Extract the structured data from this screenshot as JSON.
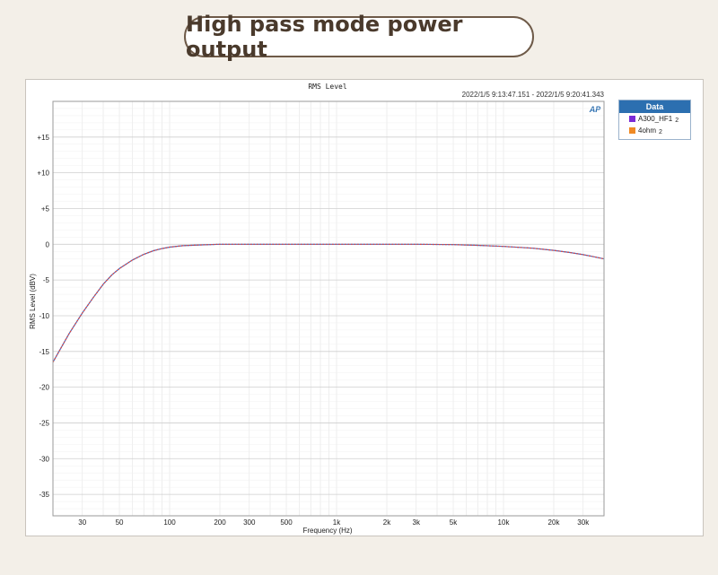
{
  "banner": {
    "title": "High pass mode power output"
  },
  "chart_data": {
    "type": "line",
    "title": "RMS Level",
    "timestamp": "2022/1/5 9:13:47.151 -   2022/1/5 9:20:41.343",
    "logo": "AP",
    "xlabel": "Frequency (Hz)",
    "ylabel": "RMS Level (dBV)",
    "x_scale": "log",
    "xlim": [
      20,
      40000
    ],
    "ylim": [
      -38,
      20
    ],
    "grid": true,
    "legend_position": "right",
    "legend_title": "Data",
    "x_ticks": [
      {
        "value": 30,
        "label": "30"
      },
      {
        "value": 50,
        "label": "50"
      },
      {
        "value": 100,
        "label": "100"
      },
      {
        "value": 200,
        "label": "200"
      },
      {
        "value": 300,
        "label": "300"
      },
      {
        "value": 500,
        "label": "500"
      },
      {
        "value": 1000,
        "label": "1k"
      },
      {
        "value": 2000,
        "label": "2k"
      },
      {
        "value": 3000,
        "label": "3k"
      },
      {
        "value": 5000,
        "label": "5k"
      },
      {
        "value": 10000,
        "label": "10k"
      },
      {
        "value": 20000,
        "label": "20k"
      },
      {
        "value": 30000,
        "label": "30k"
      }
    ],
    "y_ticks": [
      {
        "value": 15,
        "label": "+15"
      },
      {
        "value": 10,
        "label": "+10"
      },
      {
        "value": 5,
        "label": "+5"
      },
      {
        "value": 0,
        "label": "0"
      },
      {
        "value": -5,
        "label": "-5"
      },
      {
        "value": -10,
        "label": "-10"
      },
      {
        "value": -15,
        "label": "-15"
      },
      {
        "value": -20,
        "label": "-20"
      },
      {
        "value": -25,
        "label": "-25"
      },
      {
        "value": -30,
        "label": "-30"
      },
      {
        "value": -35,
        "label": "-35"
      }
    ],
    "x": [
      20,
      25,
      30,
      35,
      40,
      45,
      50,
      60,
      70,
      80,
      90,
      100,
      120,
      150,
      200,
      300,
      500,
      1000,
      2000,
      3000,
      5000,
      7000,
      10000,
      15000,
      20000,
      25000,
      30000,
      35000,
      40000
    ],
    "series": [
      {
        "name": "A300_HF1",
        "sub": "2",
        "color": "#7b2bd6",
        "values": [
          -16.5,
          -12.5,
          -9.6,
          -7.4,
          -5.6,
          -4.3,
          -3.4,
          -2.2,
          -1.4,
          -0.9,
          -0.6,
          -0.4,
          -0.2,
          -0.1,
          0,
          0,
          0,
          0,
          0,
          0,
          -0.05,
          -0.15,
          -0.3,
          -0.55,
          -0.85,
          -1.15,
          -1.45,
          -1.75,
          -2.05
        ]
      },
      {
        "name": "4ohm",
        "sub": "2",
        "color": "#f08a24",
        "values": [
          -16.5,
          -12.5,
          -9.6,
          -7.4,
          -5.6,
          -4.3,
          -3.4,
          -2.2,
          -1.4,
          -0.9,
          -0.6,
          -0.4,
          -0.2,
          -0.1,
          0,
          0,
          0,
          0,
          0,
          0,
          -0.05,
          -0.15,
          -0.3,
          -0.55,
          -0.85,
          -1.15,
          -1.45,
          -1.75,
          -2.05
        ]
      }
    ]
  }
}
